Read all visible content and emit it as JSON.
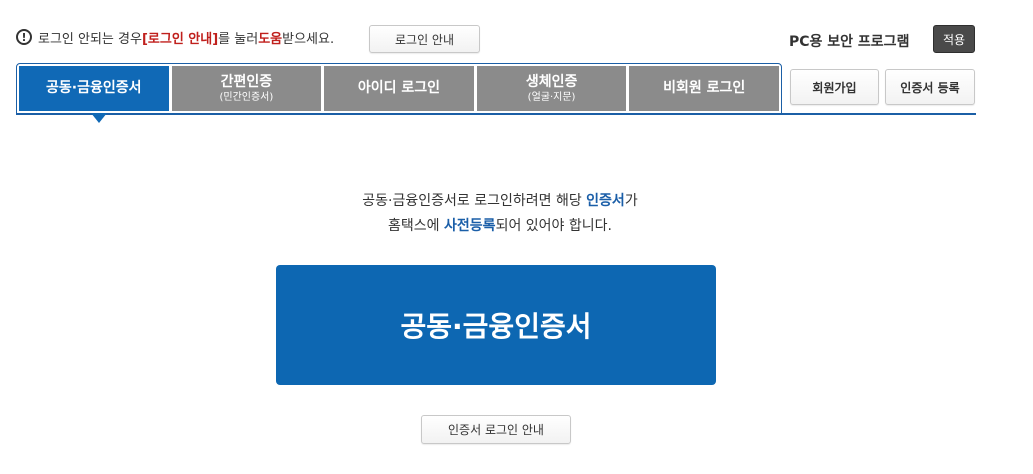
{
  "notice": {
    "prefix": "로그인 안되는 경우 ",
    "highlight1": "[로그인 안내]",
    "middle": "를 눌러 ",
    "highlight2": "도움",
    "suffix": "받으세요.",
    "icon": "exclamation-circle-icon"
  },
  "top_buttons": {
    "login_guide": "로그인 안내",
    "security_label": "PC용 보안 프로그램",
    "apply": "적용"
  },
  "tabs": [
    {
      "label": "공동·금융인증서",
      "sub": "",
      "active": true
    },
    {
      "label": "간편인증",
      "sub": "(민간인증서)",
      "active": false
    },
    {
      "label": "아이디 로그인",
      "sub": "",
      "active": false
    },
    {
      "label": "생체인증",
      "sub": "(얼굴·지문)",
      "active": false
    },
    {
      "label": "비회원 로그인",
      "sub": "",
      "active": false
    }
  ],
  "side_buttons": {
    "join": "회원가입",
    "cert_register": "인증서 등록"
  },
  "content": {
    "line1_prefix": "공동·금융인증서로 로그인하려면 해당 ",
    "line1_highlight": "인증서",
    "line1_suffix": "가",
    "line2_prefix": "홈택스에 ",
    "line2_highlight": "사전등록",
    "line2_suffix": "되어 있어야 합니다.",
    "main_button": "공동·금융인증서",
    "cert_login_guide": "인증서 로그인 안내"
  },
  "colors": {
    "accent_blue": "#1069b6",
    "tab_gray": "#8b8b8b",
    "warning_red": "#c0201d"
  }
}
